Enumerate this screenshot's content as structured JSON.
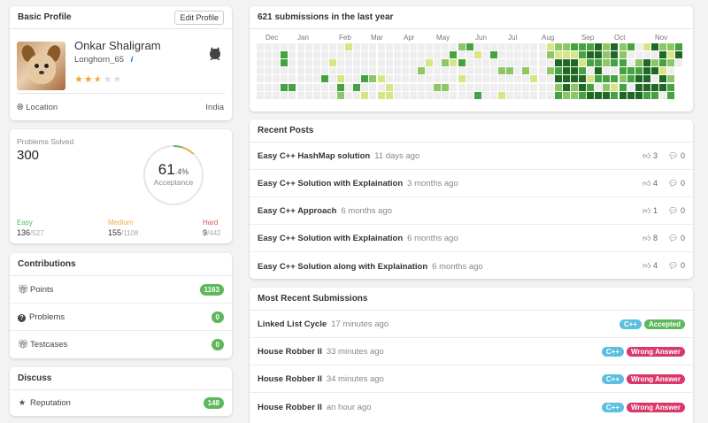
{
  "profile": {
    "header": "Basic Profile",
    "edit_label": "Edit Profile",
    "name": "Onkar Shaligram",
    "username": "Longhorn_65",
    "info_icon": "i",
    "rating_stars": 2.5,
    "location_label": "Location",
    "location_value": "India"
  },
  "solved": {
    "label": "Problems Solved",
    "total": "300",
    "acceptance_main": "61",
    "acceptance_dec": ".4%",
    "acceptance_label": "Acceptance",
    "acceptance_fraction": 0.614,
    "easy_label": "Easy",
    "easy_val": "136",
    "easy_total": "/527",
    "medium_label": "Medium",
    "medium_val": "155",
    "medium_total": "/1108",
    "hard_label": "Hard",
    "hard_val": "9",
    "hard_total": "/442",
    "colors": {
      "easy": "#5cb85c",
      "medium": "#f0ad4e",
      "hard": "#d9534f"
    }
  },
  "contributions": {
    "header": "Contributions",
    "items": [
      {
        "icon": "gift-icon",
        "label": "Points",
        "value": "1163"
      },
      {
        "icon": "question-icon",
        "label": "Problems",
        "value": "0"
      },
      {
        "icon": "gift-icon",
        "label": "Testcases",
        "value": "0"
      }
    ]
  },
  "discuss": {
    "header": "Discuss",
    "items": [
      {
        "icon": "star-icon",
        "label": "Reputation",
        "value": "148"
      }
    ]
  },
  "heatmap": {
    "title": "621 submissions in the last year",
    "months": [
      "Dec",
      "Jan",
      "Feb",
      "Mar",
      "Apr",
      "May",
      "Jun",
      "Jul",
      "Aug",
      "Sep",
      "Oct",
      "Nov"
    ],
    "palette": [
      "#eeeeee",
      "#d6e685",
      "#8cc665",
      "#44a340",
      "#1e6823"
    ]
  },
  "posts": {
    "header": "Recent Posts",
    "items": [
      {
        "title": "Easy C++ HashMap solution",
        "time": "11 days ago",
        "votes": "3",
        "comments": "0"
      },
      {
        "title": "Easy C++ Solution with Explaination",
        "time": "3 months ago",
        "votes": "4",
        "comments": "0"
      },
      {
        "title": "Easy C++ Approach",
        "time": "6 months ago",
        "votes": "1",
        "comments": "0"
      },
      {
        "title": "Easy C++ Solution with Explaination",
        "time": "6 months ago",
        "votes": "8",
        "comments": "0"
      },
      {
        "title": "Easy C++ Solution along with Explaination",
        "time": "6 months ago",
        "votes": "4",
        "comments": "0"
      }
    ]
  },
  "submissions": {
    "header": "Most Recent Submissions",
    "items": [
      {
        "title": "Linked List Cycle",
        "time": "17 minutes ago",
        "lang": "C++",
        "status": "Accepted"
      },
      {
        "title": "House Robber II",
        "time": "33 minutes ago",
        "lang": "C++",
        "status": "Wrong Answer"
      },
      {
        "title": "House Robber II",
        "time": "34 minutes ago",
        "lang": "C++",
        "status": "Wrong Answer"
      },
      {
        "title": "House Robber II",
        "time": "an hour ago",
        "lang": "C++",
        "status": "Wrong Answer"
      }
    ]
  }
}
